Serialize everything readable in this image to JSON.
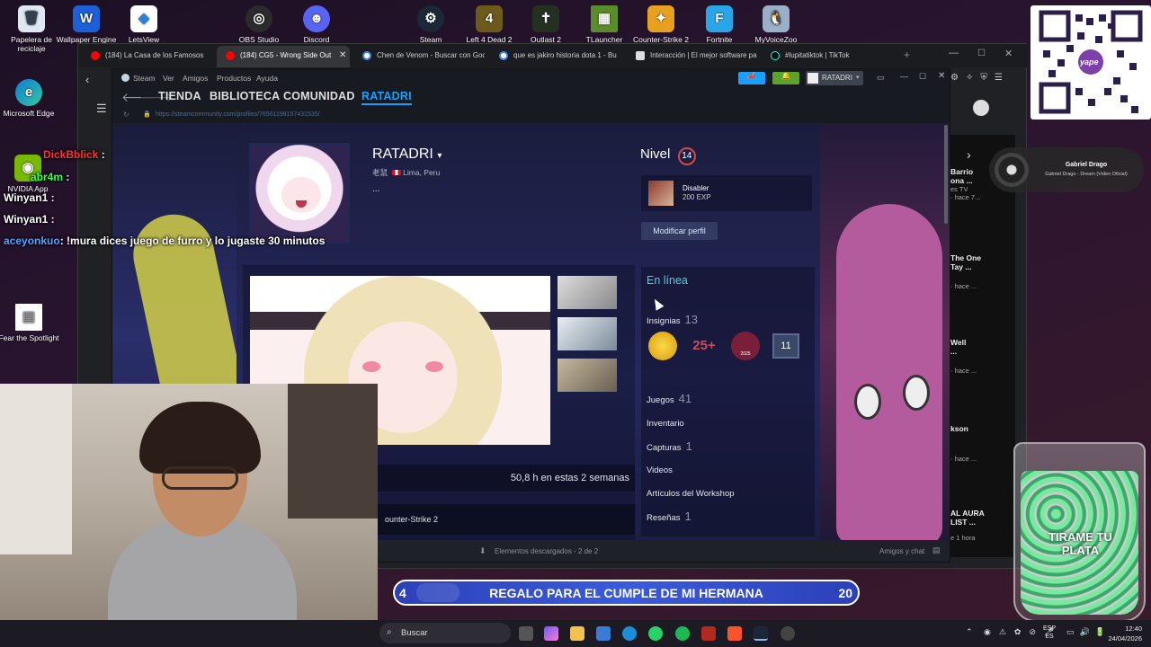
{
  "desktop_icons": [
    {
      "label": "Papelera de reciclaje",
      "icon": "recycle-bin-icon"
    },
    {
      "label": "Wallpaper Engine",
      "icon": "wallpaper-engine-icon"
    },
    {
      "label": "LetsView",
      "icon": "letsview-icon"
    },
    {
      "label": "OBS Studio",
      "icon": "obs-icon"
    },
    {
      "label": "Discord",
      "icon": "discord-icon"
    },
    {
      "label": "Steam",
      "icon": "steam-icon"
    },
    {
      "label": "Left 4 Dead 2",
      "icon": "left4dead-icon"
    },
    {
      "label": "Outlast 2",
      "icon": "outlast-icon"
    },
    {
      "label": "TLauncher",
      "icon": "tlauncher-icon"
    },
    {
      "label": "Counter-Strike 2",
      "icon": "cs2-icon"
    },
    {
      "label": "Fortnite",
      "icon": "fortnite-icon"
    },
    {
      "label": "MyVoiceZoo",
      "icon": "myvoicezoo-icon"
    },
    {
      "label": "Microsoft Edge",
      "icon": "edge-icon"
    },
    {
      "label": "NVIDIA App",
      "icon": "nvidia-icon"
    },
    {
      "label": "Fear the Spotlight",
      "icon": "file-icon"
    }
  ],
  "browser": {
    "tabs": [
      {
        "label": "(184) La Casa de los Famosos",
        "icon": "youtube-icon"
      },
      {
        "label": "(184) CG5 - Wrong Side Out",
        "icon": "youtube-icon"
      },
      {
        "label": "Chen de Venom - Buscar con Goo",
        "icon": "google-icon"
      },
      {
        "label": "que es jakiro historia dota 1 - Bu",
        "icon": "google-icon"
      },
      {
        "label": "Interacción | El mejor software pa",
        "icon": "web-icon"
      },
      {
        "label": "#lupitatiktok | TikTok",
        "icon": "tiktok-icon"
      }
    ]
  },
  "steam": {
    "menu": [
      "Steam",
      "Ver",
      "Amigos",
      "Productos",
      "Ayuda"
    ],
    "nav": [
      "TIENDA",
      "BIBLIOTECA",
      "COMUNIDAD",
      "RATADRI"
    ],
    "active_nav": "RATADRI",
    "url": "https://steamcommunity.com/profiles/76561198157431535/",
    "account_name": "RATADRI",
    "footer_downloads": "Elementos descargados - 2 de 2",
    "footer_friends": "Amigos y chat"
  },
  "profile": {
    "name": "RATADRI",
    "realname": "老鼠",
    "location": "Lima, Peru",
    "summary": "...",
    "level_label": "Nivel",
    "level": "14",
    "featured_badge_name": "Disabler",
    "featured_badge_xp": "200 EXP",
    "edit_button": "Modificar perfil",
    "status": "En línea",
    "badges_label": "Insignias",
    "badges_count": "13",
    "badge_icons": [
      {
        "icon": "gold-coin-badge-icon"
      },
      {
        "icon": "years-badge-icon",
        "text": "25+"
      },
      {
        "icon": "steam-2025-badge-icon",
        "text": "2025"
      },
      {
        "icon": "level-badge-icon",
        "text": "11"
      }
    ],
    "games_label": "Juegos",
    "games_count": "41",
    "inventory_label": "Inventario",
    "screenshots_label": "Capturas",
    "screenshots_count": "1",
    "videos_label": "Videos",
    "workshop_label": "Artículos del Workshop",
    "reviews_label": "Reseñas",
    "reviews_count": "1",
    "recent_activity": "50,8 h en estas 2 semanas",
    "recent_game": "ounter-Strike 2"
  },
  "chat": [
    {
      "user": "DickBblick",
      "msg": ":",
      "color": "#ff3030"
    },
    {
      "user": "abr4m",
      "msg": ":",
      "color": "#30ff50"
    },
    {
      "user": "Winyan1",
      "msg": ":",
      "color": "#ffffff"
    },
    {
      "user": "Winyan1",
      "msg": ":",
      "color": "#ffffff"
    },
    {
      "user": "aceyonkuo",
      "msg": ": !mura dices juego de furro y lo jugaste 30 minutos",
      "color": "#4fa3ff"
    }
  ],
  "right_sidebar": {
    "now_playing_title": "Gabriel Drago",
    "now_playing_sub": "Gabriel Drago - Dream (Video Oficial)",
    "items": [
      {
        "title": "Barrio",
        "sub": "ona ...",
        "meta": "es TV",
        "time": "· hace 7..."
      },
      {
        "title": "The One",
        "sub": "Tay ...",
        "meta": "",
        "time": "· hace ..."
      },
      {
        "title": "Well",
        "sub": "...",
        "meta": "",
        "time": "· hace ..."
      },
      {
        "title": "kson",
        "sub": "",
        "meta": "",
        "time": "· hace ..."
      },
      {
        "title": "AL AURA",
        "sub": "LIST ...",
        "meta": "",
        "time": "e 1 hora"
      }
    ]
  },
  "goal_banner": {
    "left": "4",
    "text": "REGALO PARA EL CUMPLE DE MI HERMANA",
    "right": "20"
  },
  "jar_text": "TIRAME TU PLATA",
  "qr_label": "yape",
  "taskbar": {
    "search_placeholder": "Buscar",
    "lang": "ESP",
    "lang2": "ES",
    "time": "12:40",
    "date": "24/04/2026"
  },
  "colors": {
    "steam_blue": "#1a9fff",
    "profile_bg": "#25285c",
    "banner": "#3a5bdc"
  }
}
